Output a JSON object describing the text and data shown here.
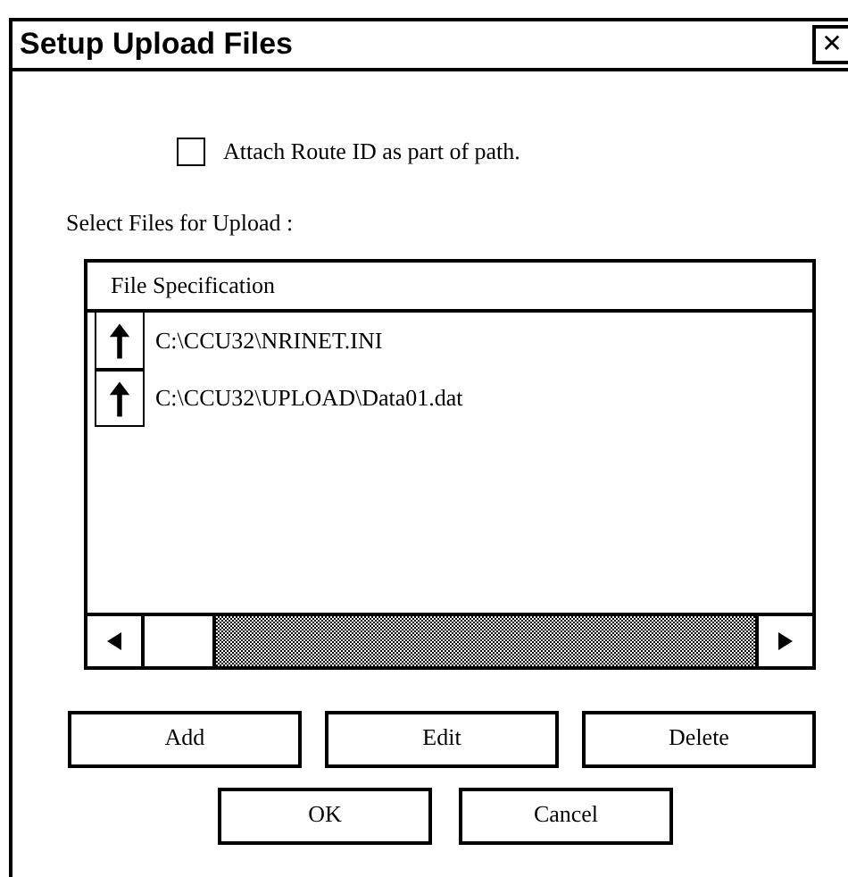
{
  "window": {
    "title": "Setup Upload Files",
    "close": "✕"
  },
  "attach_route_id": {
    "label": "Attach Route ID as part of path.",
    "checked": false
  },
  "list_label": "Select Files for Upload :",
  "file_list": {
    "columns": [
      "File Specification"
    ],
    "rows": [
      {
        "path": "C:\\CCU32\\NRINET.INI"
      },
      {
        "path": "C:\\CCU32\\UPLOAD\\Data01.dat"
      }
    ]
  },
  "buttons": [
    {
      "label": "Add"
    },
    {
      "label": "Edit"
    },
    {
      "label": "Delete"
    }
  ],
  "dialog_buttons": [
    {
      "label": "OK"
    },
    {
      "label": "Cancel"
    }
  ]
}
